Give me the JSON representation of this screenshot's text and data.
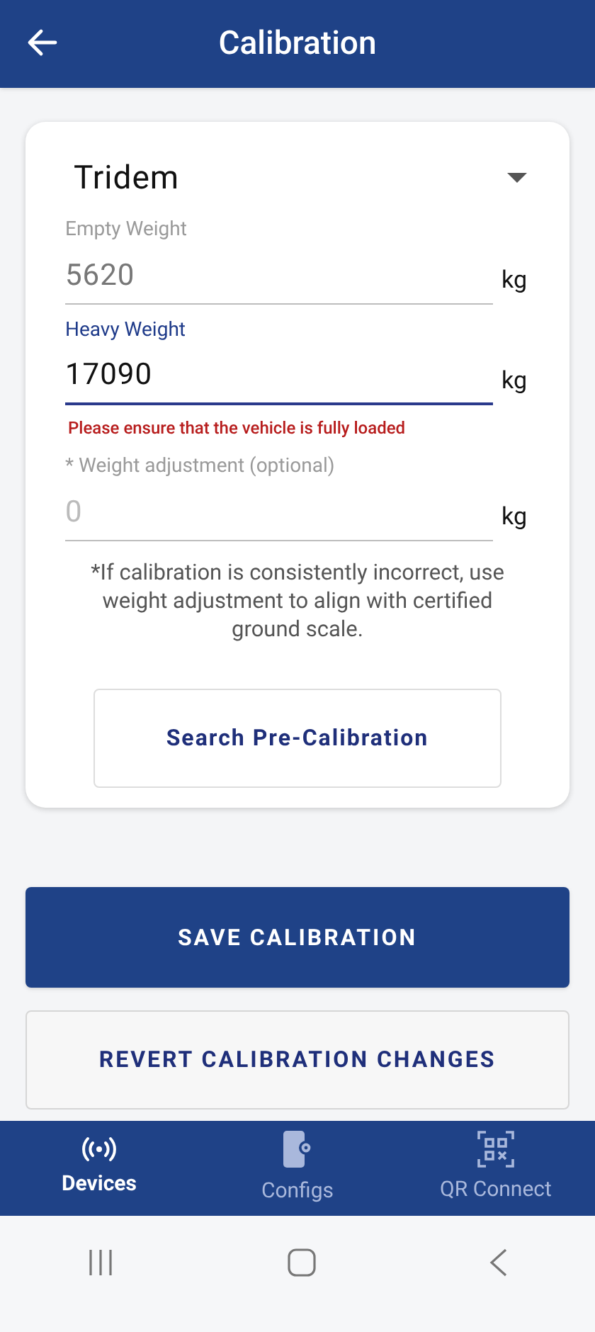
{
  "header": {
    "title": "Calibration"
  },
  "vehicle_select": {
    "value": "Tridem"
  },
  "fields": [
    {
      "label": "Empty Weight",
      "value": "5620",
      "unit": "kg",
      "disabled": true,
      "focused": false
    },
    {
      "label": "Heavy Weight",
      "value": "17090",
      "unit": "kg",
      "disabled": false,
      "focused": true,
      "error": "Please ensure that the vehicle is fully loaded"
    },
    {
      "label": "* Weight adjustment (optional)",
      "placeholder": "0",
      "unit": "kg",
      "disabled": false,
      "focused": false
    }
  ],
  "note": "*If calibration is consistently incorrect, use weight adjustment to align with certified ground scale.",
  "search_button": "Search Pre-Calibration",
  "save_button": "SAVE CALIBRATION",
  "revert_button": "REVERT CALIBRATION CHANGES",
  "bottom_nav": [
    {
      "kind": "devices",
      "label": "Devices",
      "selected": true
    },
    {
      "kind": "configs",
      "label": "Configs",
      "selected": false
    },
    {
      "kind": "qr",
      "label": "QR Connect",
      "selected": false
    }
  ]
}
